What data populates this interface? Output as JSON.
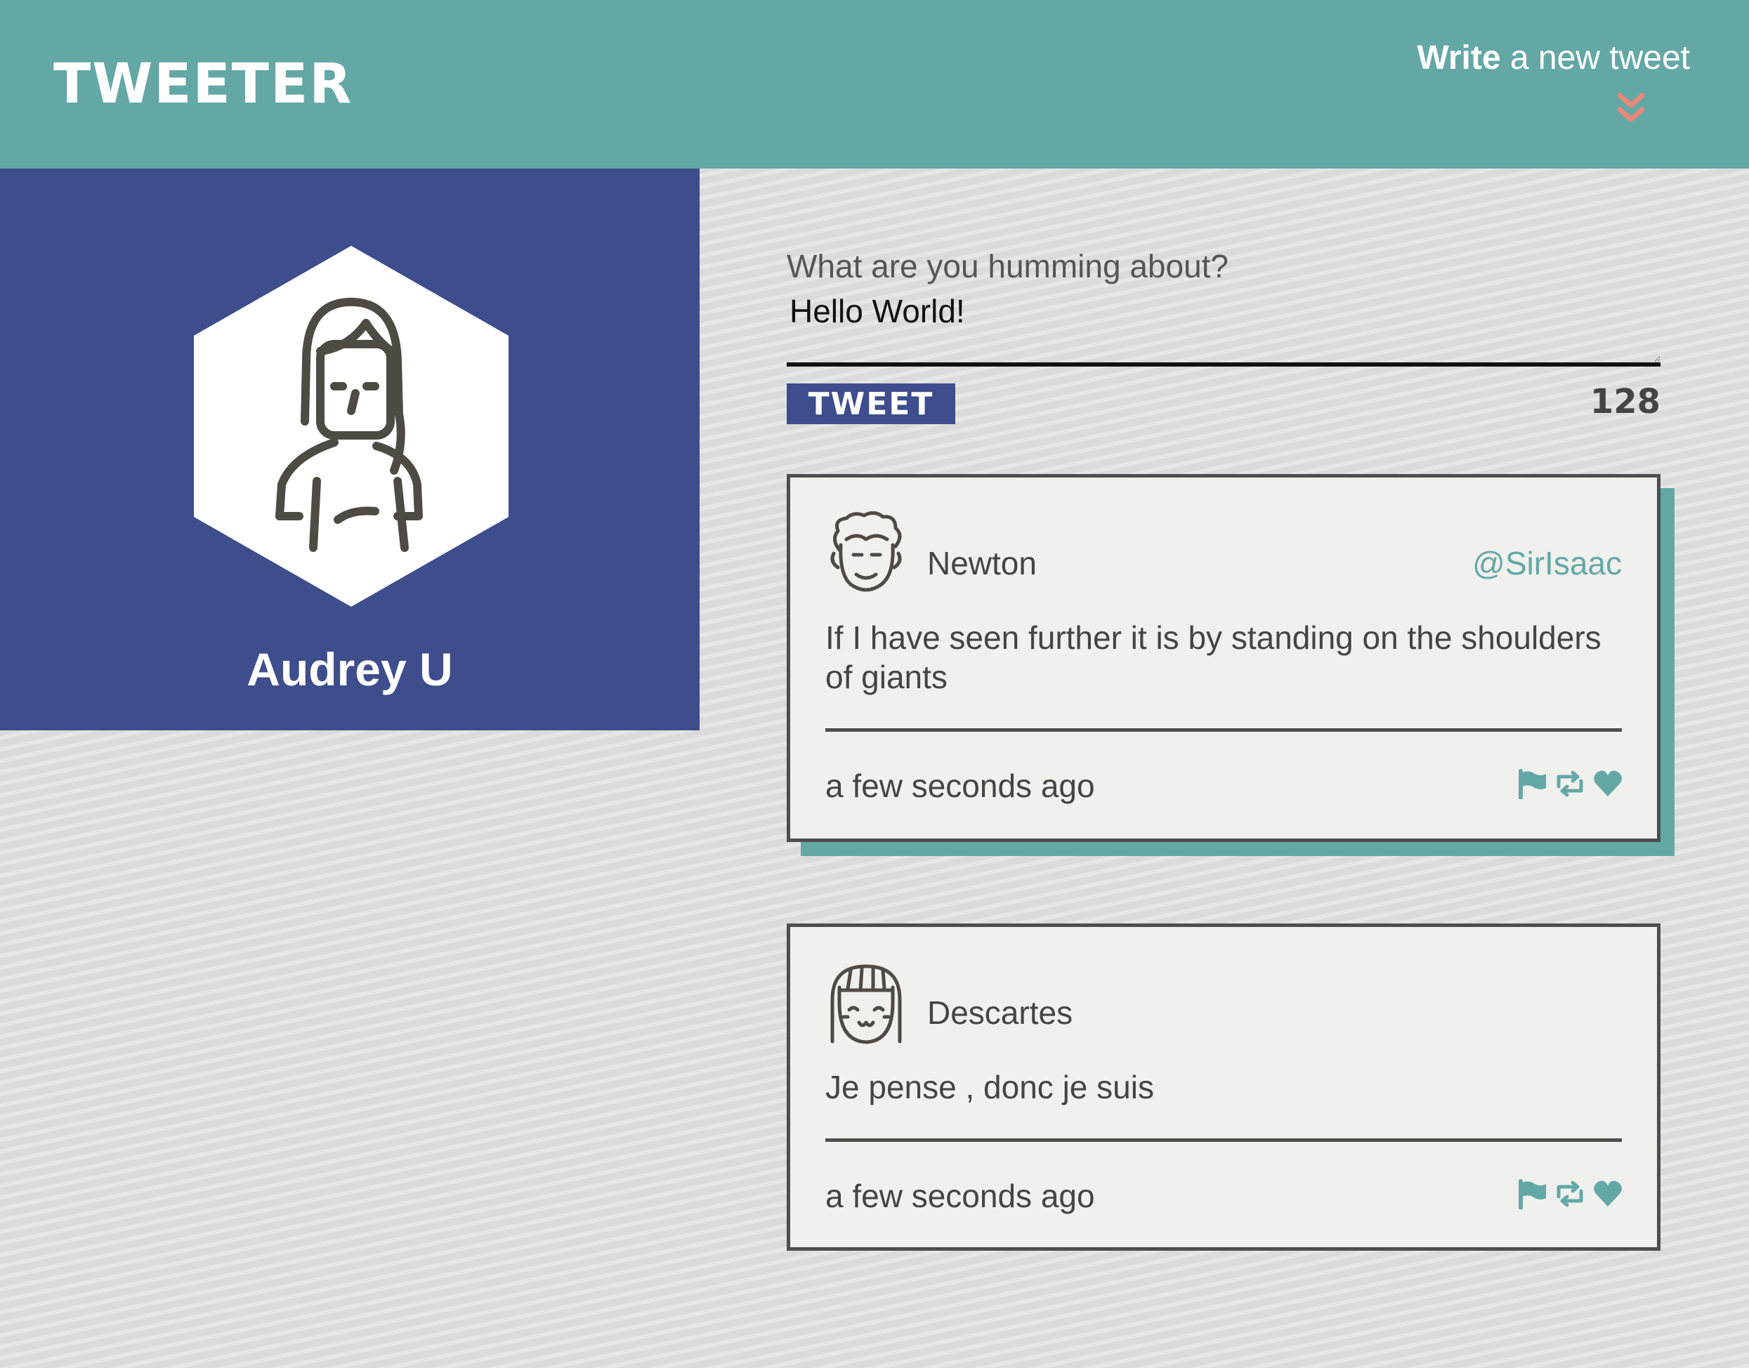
{
  "header": {
    "logo": "TWEETER",
    "compose_toggle": {
      "bold": "Write",
      "rest": " a new tweet"
    }
  },
  "profile": {
    "name": "Audrey U"
  },
  "composer": {
    "label": "What are you humming about?",
    "value": "Hello World!",
    "button_label": "TWEET",
    "char_count": "128"
  },
  "tweets": [
    {
      "name": "Newton",
      "handle": "@SirIsaac",
      "text": "If I have seen further it is by standing on the shoulders of giants",
      "time": "a few seconds ago",
      "icons": [
        "flag-icon",
        "retweet-icon",
        "heart-icon"
      ]
    },
    {
      "name": "Descartes",
      "handle": "",
      "text": "Je pense , donc je suis",
      "time": "a few seconds ago",
      "icons": [
        "flag-icon",
        "retweet-icon",
        "heart-icon"
      ]
    }
  ],
  "colors": {
    "header_bg": "#64a8a6",
    "profile_bg": "#3e4d8c",
    "accent": "#64a8a6",
    "chevron": "#e8887a",
    "tweet_bg": "#f0f0ed",
    "border": "#4e4e4e"
  }
}
